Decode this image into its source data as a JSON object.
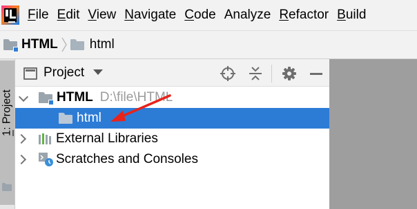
{
  "menubar": {
    "items": [
      {
        "mnemonic": "F",
        "rest": "ile"
      },
      {
        "mnemonic": "E",
        "rest": "dit"
      },
      {
        "mnemonic": "V",
        "rest": "iew"
      },
      {
        "mnemonic": "N",
        "rest": "avigate"
      },
      {
        "mnemonic": "C",
        "rest": "ode"
      },
      {
        "mnemonic": "",
        "rest": "Analyze"
      },
      {
        "mnemonic": "R",
        "rest": "efactor"
      },
      {
        "mnemonic": "B",
        "rest": "uild"
      }
    ]
  },
  "breadcrumb": {
    "items": [
      "HTML",
      "html"
    ]
  },
  "tool_stripe": {
    "mnemonic": "1",
    "label_rest": ": Project"
  },
  "project_panel": {
    "title": "Project",
    "tree": [
      {
        "label": "HTML",
        "path": "D:\\file\\HTML",
        "expanded": true
      },
      {
        "label": "html",
        "selected": true
      },
      {
        "label": "External Libraries",
        "expanded": false
      },
      {
        "label": "Scratches and Consoles",
        "expanded": false
      }
    ]
  },
  "colors": {
    "selection": "#2c7cd6",
    "annotation_arrow": "#e8231a",
    "editor_background": "#9e9e9e"
  },
  "icons": [
    "intellij-logo",
    "folder-icon",
    "crosshair-icon",
    "collapse-all-icon",
    "gear-icon",
    "minimize-icon",
    "libraries-icon",
    "scratches-icon"
  ]
}
